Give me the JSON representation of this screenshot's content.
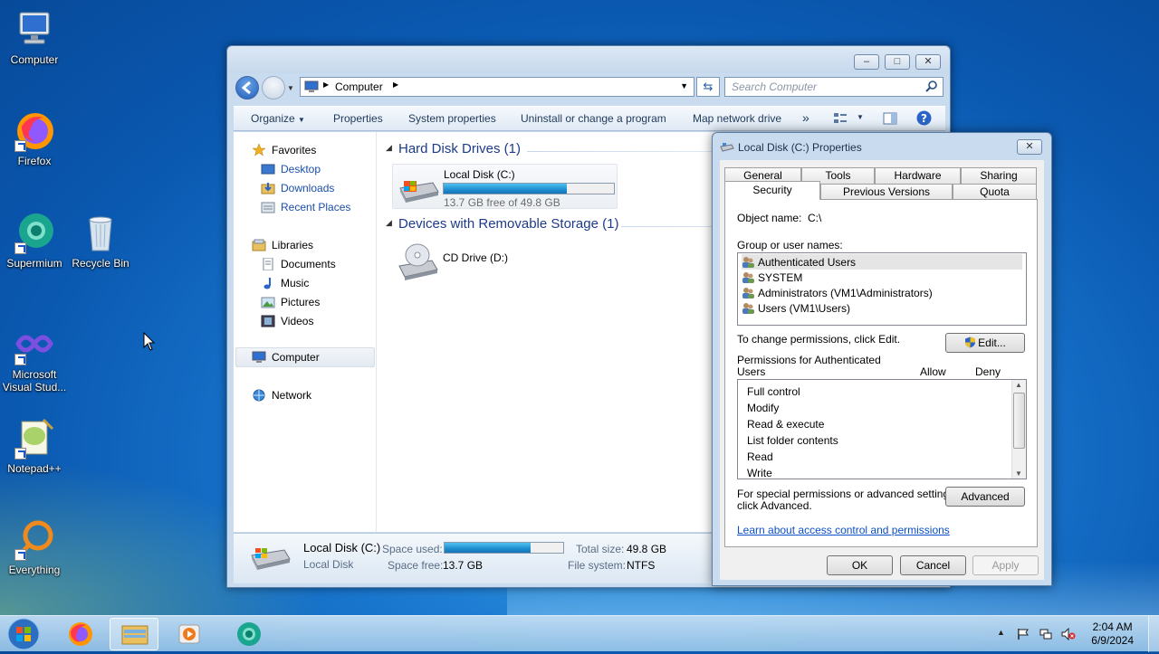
{
  "desktop": {
    "icons": [
      {
        "label": "Computer"
      },
      {
        "label": "Firefox"
      },
      {
        "label": "Supermium"
      },
      {
        "label": "Recycle Bin"
      },
      {
        "label": "Microsoft Visual Stud..."
      },
      {
        "label": "Notepad++"
      },
      {
        "label": "Everything"
      }
    ]
  },
  "explorer": {
    "address": {
      "crumb": "Computer"
    },
    "search_placeholder": "Search Computer",
    "toolbar": {
      "organize": "Organize",
      "properties": "Properties",
      "system_properties": "System properties",
      "uninstall": "Uninstall or change a program",
      "map_drive": "Map network drive",
      "more": "»"
    },
    "navpane": {
      "favorites": "Favorites",
      "desktop": "Desktop",
      "downloads": "Downloads",
      "recent": "Recent Places",
      "libraries": "Libraries",
      "documents": "Documents",
      "music": "Music",
      "pictures": "Pictures",
      "videos": "Videos",
      "computer": "Computer",
      "network": "Network"
    },
    "groups": {
      "hdd": "Hard Disk Drives (1)",
      "removable": "Devices with Removable Storage (1)"
    },
    "drives": {
      "c_name": "Local Disk (C:)",
      "c_free": "13.7 GB free of 49.8 GB",
      "c_used_fraction": 0.725,
      "d_name": "CD Drive (D:)"
    },
    "details": {
      "name": "Local Disk (C:)",
      "type": "Local Disk",
      "space_used_label": "Space used:",
      "space_free_label": "Space free:",
      "space_free": "13.7 GB",
      "total_size_label": "Total size:",
      "total_size": "49.8 GB",
      "fs_label": "File system:",
      "fs": "NTFS"
    }
  },
  "dialog": {
    "title": "Local Disk (C:) Properties",
    "tabs_row1": [
      "General",
      "Tools",
      "Hardware",
      "Sharing"
    ],
    "tabs_row2": [
      "Security",
      "Previous Versions",
      "Quota"
    ],
    "object_name_label": "Object name:",
    "object_name": "C:\\",
    "group_label": "Group or user names:",
    "users": [
      "Authenticated Users",
      "SYSTEM",
      "Administrators (VM1\\Administrators)",
      "Users (VM1\\Users)"
    ],
    "change_text": "To change permissions, click Edit.",
    "edit_button": "Edit...",
    "perm_for_line1": "Permissions for Authenticated",
    "perm_for_line2": "Users",
    "allow": "Allow",
    "deny": "Deny",
    "permissions": [
      "Full control",
      "Modify",
      "Read & execute",
      "List folder contents",
      "Read",
      "Write"
    ],
    "special_line1": "For special permissions or advanced settings,",
    "special_line2": "click Advanced.",
    "advanced_button": "Advanced",
    "learn_link": "Learn about access control and permissions",
    "ok": "OK",
    "cancel": "Cancel",
    "apply": "Apply"
  },
  "taskbar": {
    "time": "2:04 AM",
    "date": "6/9/2024"
  }
}
